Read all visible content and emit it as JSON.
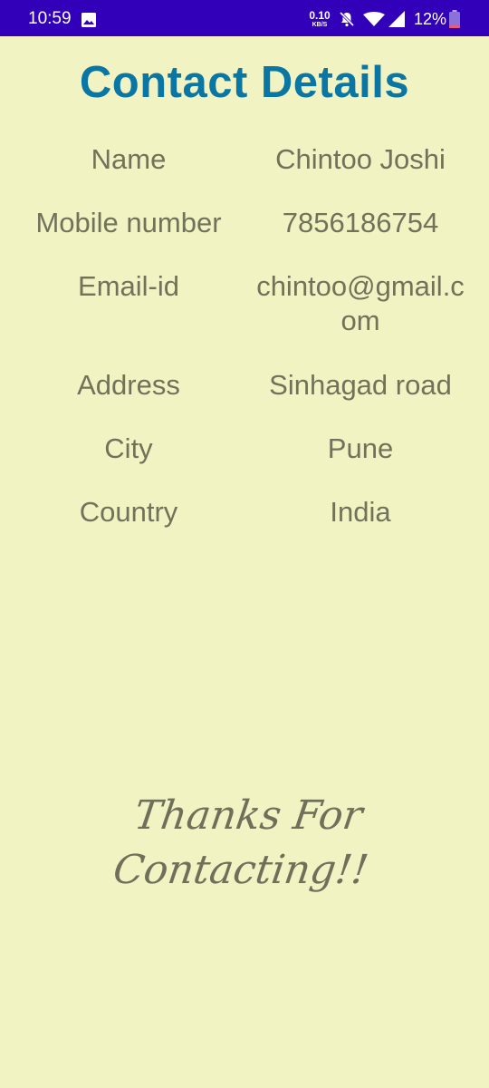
{
  "status_bar": {
    "time": "10:59",
    "net_speed": "0.10",
    "net_unit": "KB/S",
    "battery": "12%",
    "icons": [
      "gallery-icon",
      "mute-icon",
      "wifi-icon",
      "signal-icon",
      "battery-icon"
    ],
    "background_color": "#3200b8"
  },
  "title": "Contact Details",
  "details": [
    {
      "label": "Name",
      "value": "Chintoo Joshi"
    },
    {
      "label": "Mobile number",
      "value": "7856186754"
    },
    {
      "label": "Email-id",
      "value": "chintoo@gmail.com"
    },
    {
      "label": "Address",
      "value": "Sinhagad road"
    },
    {
      "label": "City",
      "value": "Pune"
    },
    {
      "label": "Country",
      "value": "India"
    }
  ],
  "footer": "Thanks For Contacting!!",
  "colors": {
    "background": "#f1f3c3",
    "title": "#0a76a3",
    "text": "#72725a"
  }
}
